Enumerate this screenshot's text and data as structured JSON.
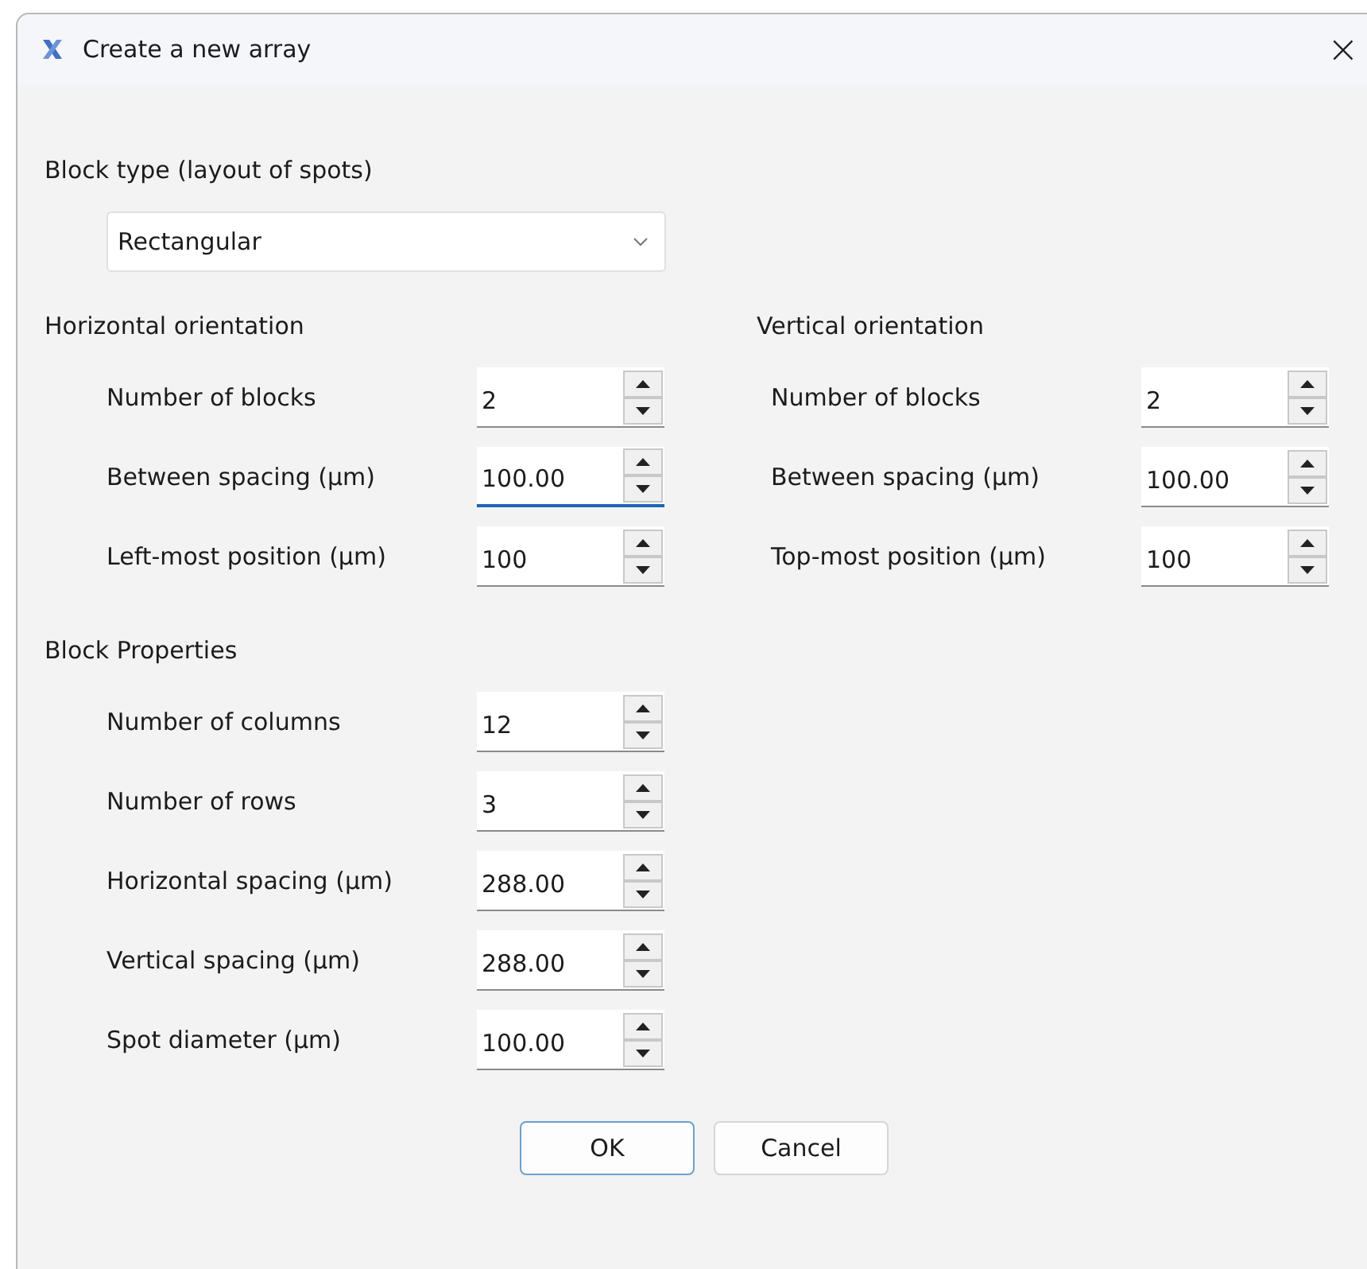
{
  "window": {
    "title": "Create a new array",
    "close": "×"
  },
  "block_type": {
    "label": "Block type (layout of spots)",
    "value": "Rectangular"
  },
  "horizontal": {
    "title": "Horizontal orientation",
    "fields": [
      {
        "label": "Number of blocks",
        "value": "2",
        "focused": false
      },
      {
        "label": "Between spacing (µm)",
        "value": "100.00",
        "focused": true
      },
      {
        "label": "Left-most position (µm)",
        "value": "100",
        "focused": false
      }
    ]
  },
  "vertical": {
    "title": "Vertical orientation",
    "fields": [
      {
        "label": "Number of blocks",
        "value": "2",
        "focused": false
      },
      {
        "label": "Between spacing (µm)",
        "value": "100.00",
        "focused": false
      },
      {
        "label": "Top-most position (µm)",
        "value": "100",
        "focused": false
      }
    ]
  },
  "block_properties": {
    "title": "Block Properties",
    "fields": [
      {
        "label": "Number of columns",
        "value": "12",
        "focused": false
      },
      {
        "label": "Number of rows",
        "value": "3",
        "focused": false
      },
      {
        "label": "Horizontal spacing (µm)",
        "value": "288.00",
        "focused": false
      },
      {
        "label": "Vertical spacing (µm)",
        "value": "288.00",
        "focused": false
      },
      {
        "label": "Spot diameter (µm)",
        "value": "100.00",
        "focused": false
      }
    ]
  },
  "buttons": [
    {
      "label": "OK",
      "default": true
    },
    {
      "label": "Cancel",
      "default": false
    }
  ]
}
